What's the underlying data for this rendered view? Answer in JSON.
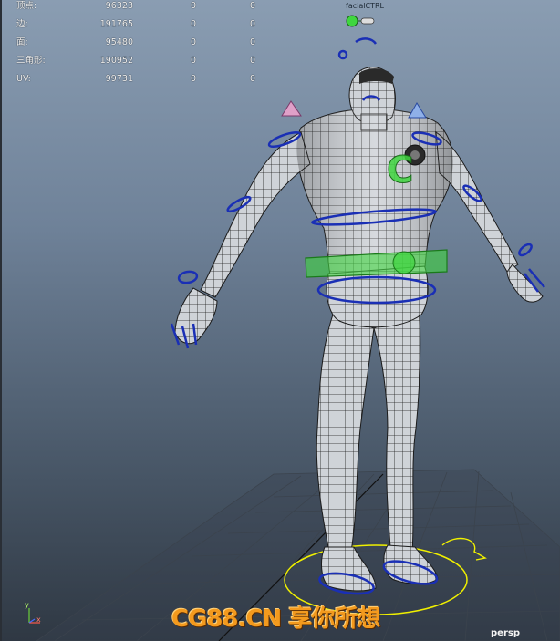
{
  "heads_up_display": {
    "rows": [
      {
        "label": "顶点:",
        "values": [
          "96323",
          "0",
          "0"
        ]
      },
      {
        "label": "边:",
        "values": [
          "191765",
          "0",
          "0"
        ]
      },
      {
        "label": "面:",
        "values": [
          "95480",
          "0",
          "0"
        ]
      },
      {
        "label": "三角形:",
        "values": [
          "190952",
          "0",
          "0"
        ]
      },
      {
        "label": "UV:",
        "values": [
          "99731",
          "0",
          "0"
        ]
      }
    ]
  },
  "controls": {
    "facial_label": "facialCTRL"
  },
  "axis_gizmo": {
    "y": "y",
    "x": "x"
  },
  "camera": {
    "name": "persp"
  },
  "watermark": {
    "text": "CG88.CN 享你所想"
  },
  "colors": {
    "wireframe": "#1b1b1b",
    "mesh_fill": "#c9cdd2",
    "control_blue": "#1a2fb5",
    "control_green": "#3fd63f",
    "control_yellow": "#f0f000",
    "control_pink": "#e0a0c8",
    "watermark_orange": "#f39a1e"
  }
}
